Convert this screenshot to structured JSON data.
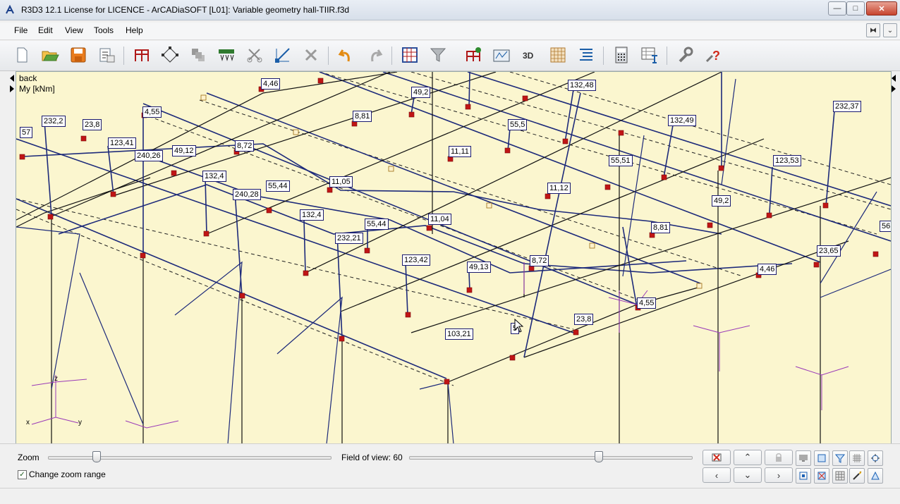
{
  "window": {
    "title": "R3D3 12.1 License for LICENCE - ArCADiaSOFT [L01]: Variable geometry hall-TIIR.f3d",
    "minimize_glyph": "—",
    "maximize_glyph": "□",
    "close_glyph": "✕"
  },
  "menu": {
    "file": "File",
    "edit": "Edit",
    "view": "View",
    "tools": "Tools",
    "help": "Help"
  },
  "mdi": {
    "restore_glyph": "⧓",
    "menu_glyph": "⌄"
  },
  "toolbar_icons": [
    "new-icon",
    "open-icon",
    "save-icon",
    "properties-icon",
    "frame-icon",
    "add-node-icon",
    "tiles-icon",
    "load-icon",
    "scissors-icon",
    "axis-icon",
    "delete-icon",
    "undo-icon",
    "redo-icon",
    "grid-view-icon",
    "filter-icon",
    "calculation-icon",
    "result-icon",
    "3d-icon",
    "mesh-icon",
    "list-icon",
    "calculator-icon",
    "table-icon",
    "settings-icon",
    "help-icon"
  ],
  "viewport": {
    "view_name": "back",
    "result_name": "My [kNm]",
    "axis_z": "z",
    "axis_x": "x",
    "axis_y": "y",
    "labels": [
      "4,46",
      "49,2",
      "132,48",
      "4,55",
      "8,81",
      "232,2",
      "23,8",
      "57",
      "123,41",
      "240,26",
      "49,12",
      "8,72",
      "55,5",
      "132,49",
      "11,11",
      "232,37",
      "132,4",
      "55,51",
      "240,28",
      "55,44",
      "11,05",
      "123,53",
      "11,12",
      "49,2",
      "132,4",
      "55,44",
      "11,04",
      "8,81",
      "56",
      "232,21",
      "123,42",
      "49,13",
      "8,72",
      "23,65",
      "4,46",
      "4,55",
      "23,8",
      "103,21",
      "5"
    ]
  },
  "bottom": {
    "zoom_label": "Zoom",
    "zoom_value": 0.17,
    "fov_label": "Field of view: 60",
    "fov_value": 0.67,
    "checkbox_label": "Change zoom range",
    "checkbox_checked": true,
    "checkmark": "✓",
    "nav_up": "⌃",
    "nav_left": "‹",
    "nav_down": "⌄",
    "nav_right": "›"
  }
}
